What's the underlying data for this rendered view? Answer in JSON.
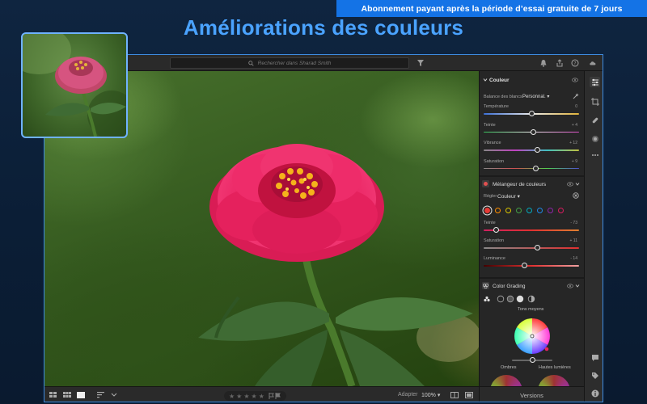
{
  "banner": {
    "text": "Abonnement payant après la période d’essai gratuite de 7 jours"
  },
  "headline": {
    "text": "Améliorations des couleurs"
  },
  "topbar": {
    "search_placeholder": "Rechercher dans Sharad Smith"
  },
  "colors": {
    "accent": "#1473e6",
    "headline": "#4aa3ff",
    "panel_bg": "#262626",
    "flower": "#e8245e"
  },
  "panel": {
    "color_section": {
      "title": "Couleur",
      "white_balance_label": "Balance des blancs",
      "white_balance_value": "Personnal.",
      "sliders": [
        {
          "label": "Température",
          "value": "0",
          "level": 0.5
        },
        {
          "label": "Teinte",
          "value": "+ 4",
          "level": 0.52
        },
        {
          "label": "Vibrance",
          "value": "+ 12",
          "level": 0.56
        },
        {
          "label": "Saturation",
          "value": "+ 9",
          "level": 0.55
        }
      ]
    },
    "mixer_section": {
      "title": "Mélangeur de couleurs",
      "adjust_label": "Régler",
      "adjust_value": "Couleur",
      "swatches": [
        "#e53935",
        "#ff8f00",
        "#d8c400",
        "#43a047",
        "#00acc1",
        "#1e88e5",
        "#8e24aa",
        "#d81b60"
      ],
      "sliders": [
        {
          "label": "Teinte",
          "value": "- 73",
          "level": 0.13
        },
        {
          "label": "Saturation",
          "value": "+ 11",
          "level": 0.56
        },
        {
          "label": "Luminance",
          "value": "- 14",
          "level": 0.43
        }
      ]
    },
    "grading_section": {
      "title": "Color Grading",
      "midtones_label": "Tons moyens",
      "shadows_label": "Ombres",
      "highlights_label": "Hautes lumières"
    },
    "versions_label": "Versions"
  },
  "bottombar": {
    "stars": "★★★★★",
    "fit_label": "Adapter",
    "zoom": "100%"
  },
  "icons": [
    "search-icon",
    "filter-icon",
    "bell-icon",
    "share-icon",
    "help-icon",
    "cloud-icon",
    "sliders-icon",
    "crop-icon",
    "healing-icon",
    "mask-icon",
    "more-icon",
    "comment-icon",
    "tag-icon",
    "info-icon",
    "grid-icon",
    "flag-icon",
    "sort-icon",
    "eye-icon",
    "eyedropper-icon",
    "chevron-down-icon"
  ]
}
